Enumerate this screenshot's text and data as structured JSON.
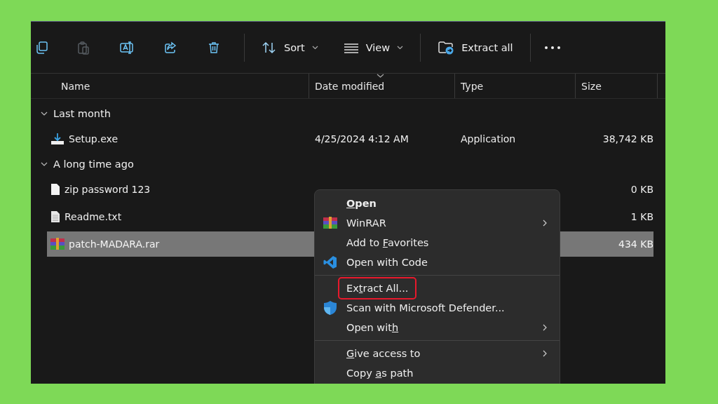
{
  "toolbar": {
    "actions": [
      {
        "kind": "copy",
        "disabled": false
      },
      {
        "kind": "paste",
        "disabled": true
      },
      {
        "kind": "rename",
        "disabled": false
      },
      {
        "kind": "share",
        "disabled": false
      },
      {
        "kind": "delete",
        "disabled": false
      }
    ],
    "menus": [
      {
        "kind": "sort",
        "label": "Sort"
      },
      {
        "kind": "view",
        "label": "View"
      }
    ],
    "extract": {
      "label": "Extract all"
    }
  },
  "columns": [
    {
      "label": "Name"
    },
    {
      "label": "Date modified",
      "sorted": true
    },
    {
      "label": "Type"
    },
    {
      "label": "Size"
    }
  ],
  "groups": [
    {
      "label": "Last month",
      "expanded": true,
      "files": [
        {
          "kind": "installer",
          "name": "Setup.exe",
          "date": "4/25/2024 4:12 AM",
          "type": "Application",
          "size": "38,742 KB",
          "selected": false
        }
      ]
    },
    {
      "label": "A long time ago",
      "expanded": true,
      "files": [
        {
          "kind": "blank",
          "name": "zip password 123",
          "size": "0 KB",
          "selected": false
        },
        {
          "kind": "text",
          "name": "Readme.txt",
          "size": "1 KB",
          "selected": false
        },
        {
          "kind": "archive",
          "name": "patch-MADARA.rar",
          "size": "434 KB",
          "selected": true
        }
      ]
    }
  ],
  "context_menu": {
    "items": [
      {
        "kind": "plain",
        "key": "O",
        "post": "pen",
        "default": true,
        "submenu": false,
        "highlighted": false
      },
      {
        "kind": "archive",
        "pre": "WinRAR",
        "default": false,
        "submenu": true,
        "highlighted": false
      },
      {
        "kind": "plain",
        "pre": "Add to ",
        "key": "F",
        "post": "avorites",
        "default": false,
        "submenu": false,
        "highlighted": false
      },
      {
        "kind": "code",
        "pre": "Open with Code",
        "default": false,
        "submenu": false,
        "highlighted": false
      },
      {
        "kind": "separator"
      },
      {
        "kind": "plain",
        "pre": "Ex",
        "key": "t",
        "post": "ract All...",
        "default": false,
        "submenu": false,
        "highlighted": true
      },
      {
        "kind": "shield",
        "pre": "Scan with Microsoft Defender...",
        "default": false,
        "submenu": false,
        "highlighted": false
      },
      {
        "kind": "plain",
        "pre": "Open wit",
        "key": "h",
        "default": false,
        "submenu": true,
        "highlighted": false
      },
      {
        "kind": "separator"
      },
      {
        "kind": "plain",
        "key": "G",
        "post": "ive access to",
        "default": false,
        "submenu": true,
        "highlighted": false
      },
      {
        "kind": "plain",
        "pre": "Copy ",
        "key": "a",
        "post": "s path",
        "default": false,
        "submenu": false,
        "highlighted": false
      }
    ]
  }
}
